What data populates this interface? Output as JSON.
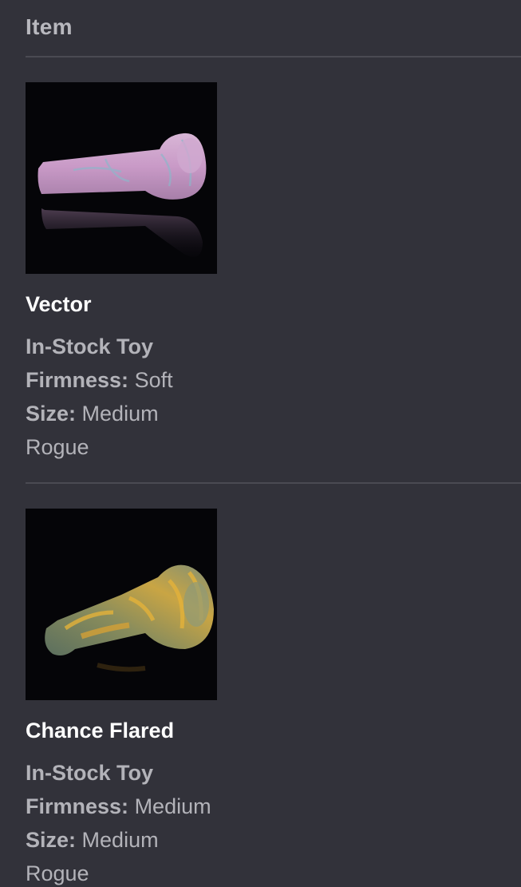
{
  "header": {
    "title": "Item"
  },
  "items": [
    {
      "name": "Vector",
      "type": "In-Stock Toy",
      "firmness_label": "Firmness:",
      "firmness_value": "Soft",
      "size_label": "Size:",
      "size_value": "Medium",
      "variant": "Rogue",
      "image": "product-photo-vector"
    },
    {
      "name": "Chance Flared",
      "type": "In-Stock Toy",
      "firmness_label": "Firmness:",
      "firmness_value": "Medium",
      "size_label": "Size:",
      "size_value": "Medium",
      "variant": "Rogue",
      "image": "product-photo-chance-flared"
    }
  ],
  "colors": {
    "background": "#32323a",
    "text_primary": "#ffffff",
    "text_secondary": "#b3b3b9",
    "divider": "#4a4a52"
  }
}
